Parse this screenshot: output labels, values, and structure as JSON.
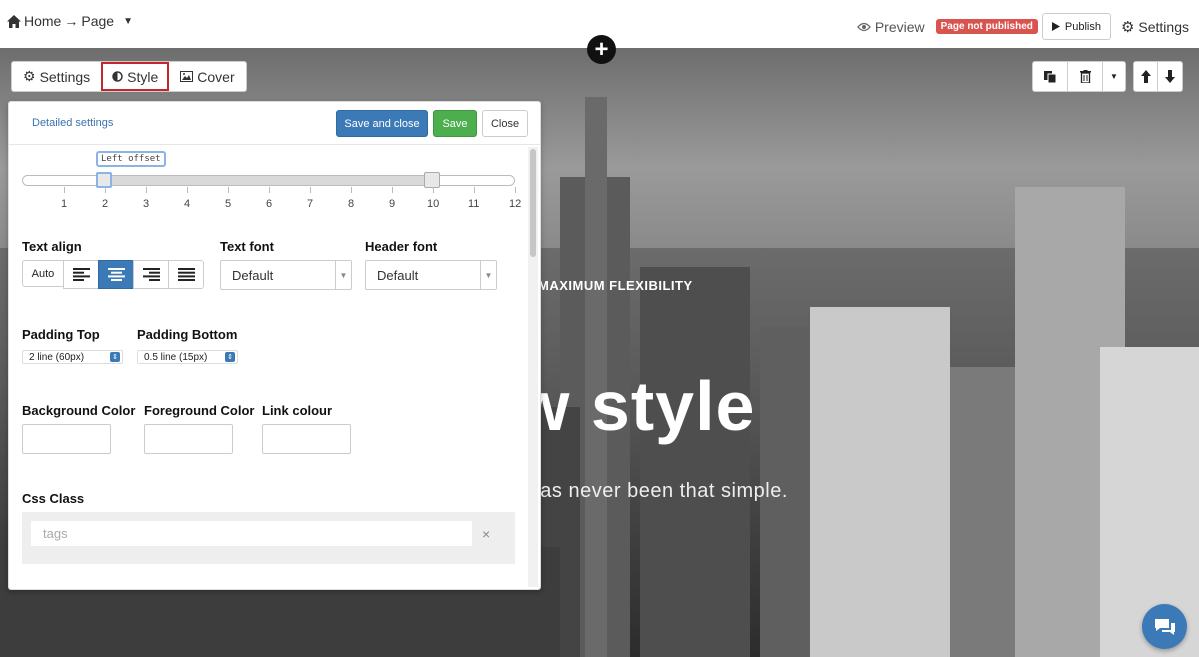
{
  "breadcrumb": {
    "home": "Home",
    "arrow": "→",
    "page": "Page"
  },
  "topbar": {
    "preview": "Preview",
    "status_badge": "Page not published",
    "publish": "Publish",
    "settings": "Settings"
  },
  "hero": {
    "subtitle": "MAXIMUM FLEXIBILITY",
    "title": "w style",
    "tagline": "e has never been that simple."
  },
  "tabs": [
    {
      "label": "Settings",
      "icon": "gear-icon"
    },
    {
      "label": "Style",
      "icon": "half-circle-icon",
      "active": true
    },
    {
      "label": "Cover",
      "icon": "image-icon"
    }
  ],
  "panel": {
    "detailed_settings": "Detailed settings",
    "save_and_close": "Save and close",
    "save": "Save",
    "close": "Close",
    "slider": {
      "tooltip": "Left offset",
      "ticks": [
        "1",
        "2",
        "3",
        "4",
        "5",
        "6",
        "7",
        "8",
        "9",
        "10",
        "11",
        "12"
      ],
      "left_value": 2,
      "right_value": 10
    },
    "text_align": {
      "label": "Text align",
      "auto": "Auto",
      "selected": "center"
    },
    "text_font": {
      "label": "Text font",
      "value": "Default"
    },
    "header_font": {
      "label": "Header font",
      "value": "Default"
    },
    "padding_top": {
      "label": "Padding Top",
      "value": "2 line (60px)"
    },
    "padding_bottom": {
      "label": "Padding Bottom",
      "value": "0.5 line (15px)"
    },
    "background_color": {
      "label": "Background Color",
      "value": ""
    },
    "foreground_color": {
      "label": "Foreground Color",
      "value": ""
    },
    "link_colour": {
      "label": "Link colour",
      "value": ""
    },
    "css_class": {
      "label": "Css Class",
      "placeholder": "tags",
      "clear": "×"
    }
  },
  "colors": {
    "accent": "#3c7ab7",
    "save": "#4cae4c",
    "badge": "#d9534f",
    "active_tab_outline": "#c0282d"
  }
}
